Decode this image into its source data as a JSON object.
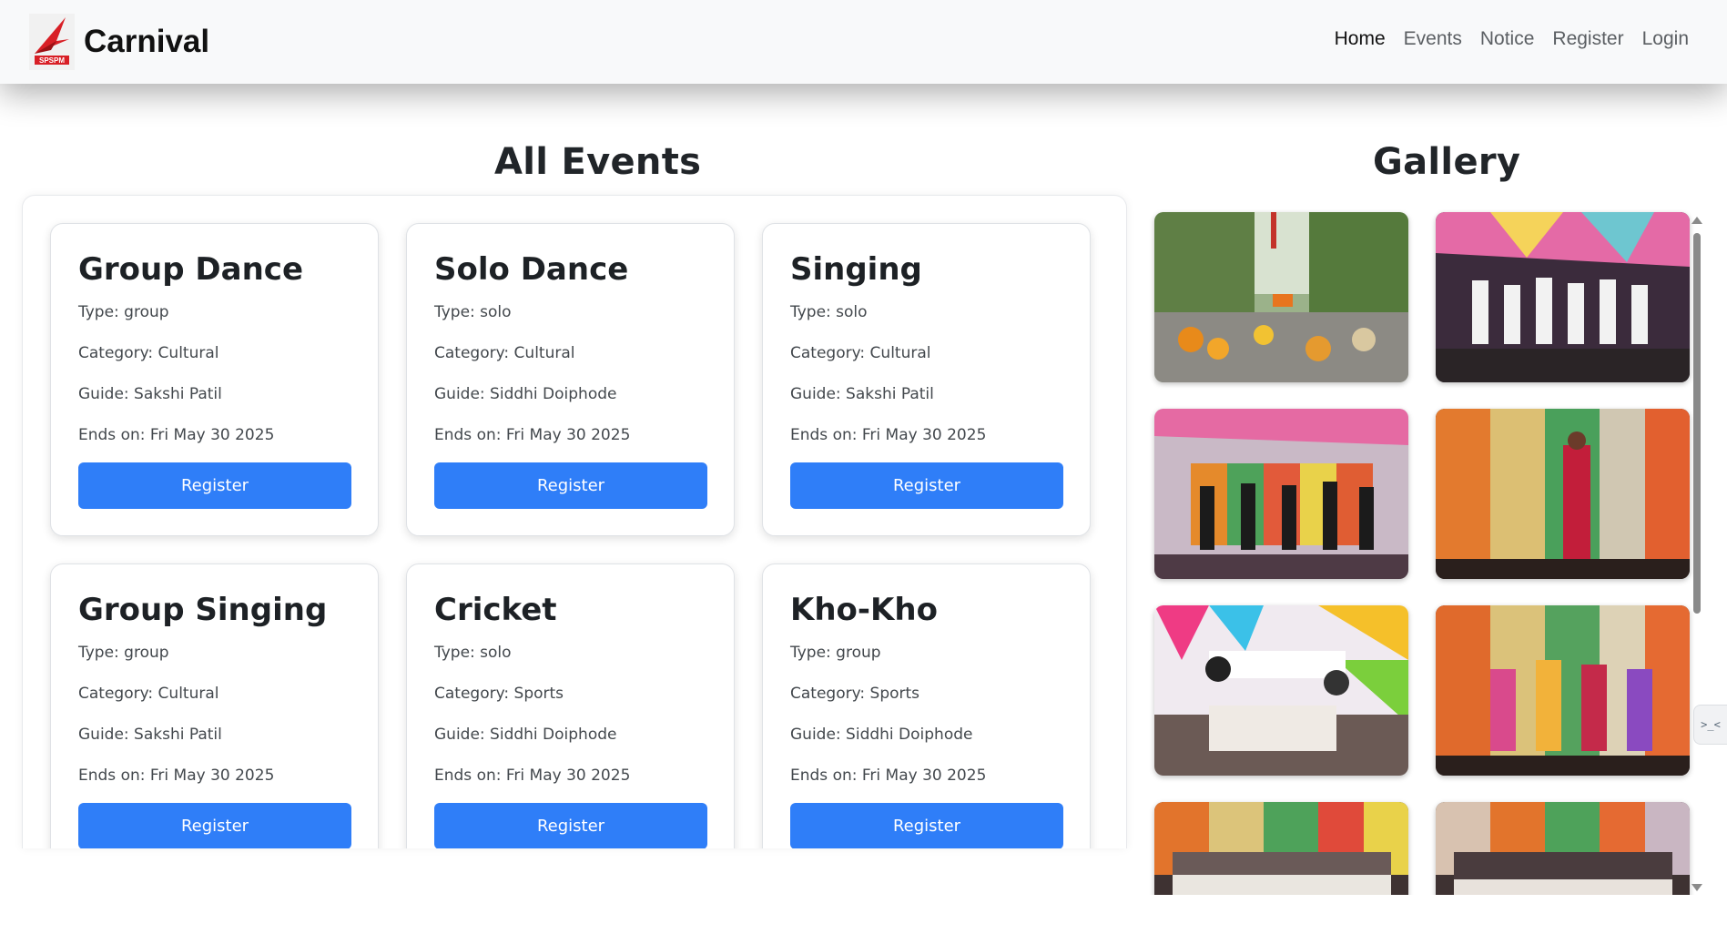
{
  "brand": {
    "name": "Carnival",
    "logo_text": "SPSPM"
  },
  "nav": {
    "items": [
      {
        "label": "Home",
        "active": true
      },
      {
        "label": "Events",
        "active": false
      },
      {
        "label": "Notice",
        "active": false
      },
      {
        "label": "Register",
        "active": false
      },
      {
        "label": "Login",
        "active": false
      }
    ]
  },
  "events_section": {
    "title": "All Events",
    "cards": [
      {
        "title": "Group Dance",
        "type": "Type: group",
        "category": "Category: Cultural",
        "guide": "Guide: Sakshi Patil",
        "ends": "Ends on: Fri May 30 2025",
        "button": "Register"
      },
      {
        "title": "Solo Dance",
        "type": "Type: solo",
        "category": "Category: Cultural",
        "guide": "Guide: Siddhi Doiphode",
        "ends": "Ends on: Fri May 30 2025",
        "button": "Register"
      },
      {
        "title": "Singing",
        "type": "Type: solo",
        "category": "Category: Cultural",
        "guide": "Guide: Sakshi Patil",
        "ends": "Ends on: Fri May 30 2025",
        "button": "Register"
      },
      {
        "title": "Group Singing",
        "type": "Type: group",
        "category": "Category: Cultural",
        "guide": "Guide: Sakshi Patil",
        "ends": "Ends on: Fri May 30 2025",
        "button": "Register"
      },
      {
        "title": "Cricket",
        "type": "Type: solo",
        "category": "Category: Sports",
        "guide": "Guide: Siddhi Doiphode",
        "ends": "Ends on: Fri May 30 2025",
        "button": "Register"
      },
      {
        "title": "Kho-Kho",
        "type": "Type: group",
        "category": "Category: Sports",
        "guide": "Guide: Siddhi Doiphode",
        "ends": "Ends on: Fri May 30 2025",
        "button": "Register"
      }
    ]
  },
  "gallery_section": {
    "title": "Gallery",
    "images": [
      {
        "name": "gallery-photo-procession"
      },
      {
        "name": "gallery-photo-group-dance-stage"
      },
      {
        "name": "gallery-photo-dance-black-outfits"
      },
      {
        "name": "gallery-photo-solo-dancer"
      },
      {
        "name": "gallery-photo-carnival-skit"
      },
      {
        "name": "gallery-photo-folk-dance"
      },
      {
        "name": "gallery-photo-prize-distribution-1"
      },
      {
        "name": "gallery-photo-prize-distribution-2"
      }
    ]
  },
  "dev_tab": {
    "label": ">_<"
  },
  "colors": {
    "primary_button": "#2f7ef8",
    "navbar_bg": "#f8f9fa",
    "brand_red": "#d81f26"
  }
}
